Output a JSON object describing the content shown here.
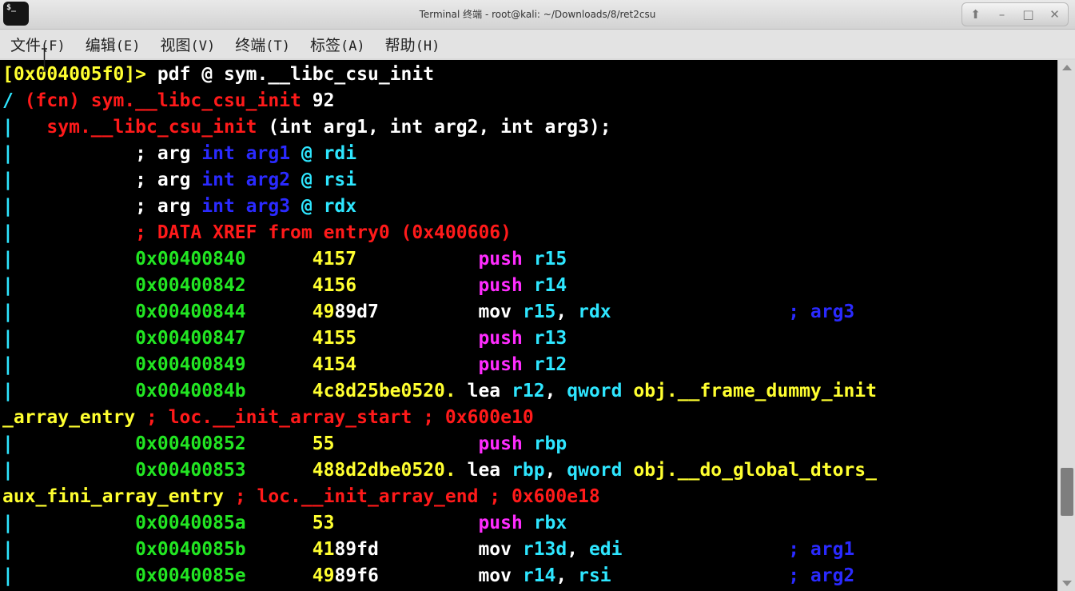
{
  "window": {
    "app_icon_text": "$_",
    "title": "Terminal 终端 - root@kali: ~/Downloads/8/ret2csu",
    "controls": {
      "up": "⬆",
      "minimize": "–",
      "maximize": "□",
      "close": "✕"
    }
  },
  "menu": [
    {
      "label": "文件",
      "accel": "(F)"
    },
    {
      "label": "编辑",
      "accel": "(E)"
    },
    {
      "label": "视图",
      "accel": "(V)"
    },
    {
      "label": "终端",
      "accel": "(T)"
    },
    {
      "label": "标签",
      "accel": "(A)"
    },
    {
      "label": "帮助",
      "accel": "(H)"
    }
  ],
  "colors": {
    "background": "#000000",
    "yellow": "#ffff30",
    "red": "#ff1a1a",
    "cyan": "#2ee6ff",
    "blue": "#2a2aff",
    "green": "#22e622",
    "magenta": "#ff2cff"
  },
  "terminal_lines": [
    [
      {
        "t": "[0x004005f0]> ",
        "c": "yellow"
      },
      {
        "t": "pdf @ sym.__libc_csu_init",
        "c": "white"
      }
    ],
    [
      {
        "t": "/ ",
        "c": "cyan"
      },
      {
        "t": "(fcn) sym.__libc_csu_init ",
        "c": "red"
      },
      {
        "t": "92",
        "c": "white"
      }
    ],
    [
      {
        "t": "|",
        "c": "cyan"
      },
      {
        "t": "   sym.__libc_csu_init ",
        "c": "red"
      },
      {
        "t": "(int arg1, int arg2, int arg3);",
        "c": "white"
      }
    ],
    [
      {
        "t": "|",
        "c": "cyan"
      },
      {
        "t": "           ; arg ",
        "c": "white"
      },
      {
        "t": "int arg1 ",
        "c": "blue"
      },
      {
        "t": "@ rdi",
        "c": "cyan"
      }
    ],
    [
      {
        "t": "|",
        "c": "cyan"
      },
      {
        "t": "           ; arg ",
        "c": "white"
      },
      {
        "t": "int arg2 ",
        "c": "blue"
      },
      {
        "t": "@ rsi",
        "c": "cyan"
      }
    ],
    [
      {
        "t": "|",
        "c": "cyan"
      },
      {
        "t": "           ; arg ",
        "c": "white"
      },
      {
        "t": "int arg3 ",
        "c": "blue"
      },
      {
        "t": "@ rdx",
        "c": "cyan"
      }
    ],
    [
      {
        "t": "|",
        "c": "cyan"
      },
      {
        "t": "           ; DATA XREF from entry0 (0x400606)",
        "c": "red"
      }
    ],
    [
      {
        "t": "|",
        "c": "cyan"
      },
      {
        "t": "           0x00400840",
        "c": "green"
      },
      {
        "t": "      4157",
        "c": "yellow"
      },
      {
        "t": "           push ",
        "c": "magenta"
      },
      {
        "t": "r15",
        "c": "cyan"
      }
    ],
    [
      {
        "t": "|",
        "c": "cyan"
      },
      {
        "t": "           0x00400842",
        "c": "green"
      },
      {
        "t": "      4156",
        "c": "yellow"
      },
      {
        "t": "           push ",
        "c": "magenta"
      },
      {
        "t": "r14",
        "c": "cyan"
      }
    ],
    [
      {
        "t": "|",
        "c": "cyan"
      },
      {
        "t": "           0x00400844",
        "c": "green"
      },
      {
        "t": "      49",
        "c": "yellow"
      },
      {
        "t": "89d7",
        "c": "white"
      },
      {
        "t": "         mov ",
        "c": "white"
      },
      {
        "t": "r15",
        "c": "cyan"
      },
      {
        "t": ", ",
        "c": "white"
      },
      {
        "t": "rdx",
        "c": "cyan"
      },
      {
        "t": "                ; ",
        "c": "blue"
      },
      {
        "t": "arg3",
        "c": "blue"
      }
    ],
    [
      {
        "t": "|",
        "c": "cyan"
      },
      {
        "t": "           0x00400847",
        "c": "green"
      },
      {
        "t": "      4155",
        "c": "yellow"
      },
      {
        "t": "           push ",
        "c": "magenta"
      },
      {
        "t": "r13",
        "c": "cyan"
      }
    ],
    [
      {
        "t": "|",
        "c": "cyan"
      },
      {
        "t": "           0x00400849",
        "c": "green"
      },
      {
        "t": "      4154",
        "c": "yellow"
      },
      {
        "t": "           push ",
        "c": "magenta"
      },
      {
        "t": "r12",
        "c": "cyan"
      }
    ],
    [
      {
        "t": "|",
        "c": "cyan"
      },
      {
        "t": "           0x0040084b",
        "c": "green"
      },
      {
        "t": "      4c8d25be0520.",
        "c": "yellow"
      },
      {
        "t": " lea ",
        "c": "white"
      },
      {
        "t": "r12",
        "c": "cyan"
      },
      {
        "t": ", ",
        "c": "white"
      },
      {
        "t": "qword ",
        "c": "cyan"
      },
      {
        "t": "obj.__frame_dummy_init",
        "c": "yellow"
      }
    ],
    [
      {
        "t": "_array_entry ",
        "c": "yellow"
      },
      {
        "t": "; loc.__init_array_start ; 0x600e10",
        "c": "red"
      }
    ],
    [
      {
        "t": "|",
        "c": "cyan"
      },
      {
        "t": "           0x00400852",
        "c": "green"
      },
      {
        "t": "      55",
        "c": "yellow"
      },
      {
        "t": "             push ",
        "c": "magenta"
      },
      {
        "t": "rbp",
        "c": "cyan"
      }
    ],
    [
      {
        "t": "|",
        "c": "cyan"
      },
      {
        "t": "           0x00400853",
        "c": "green"
      },
      {
        "t": "      488d2dbe0520.",
        "c": "yellow"
      },
      {
        "t": " lea ",
        "c": "white"
      },
      {
        "t": "rbp",
        "c": "cyan"
      },
      {
        "t": ", ",
        "c": "white"
      },
      {
        "t": "qword ",
        "c": "cyan"
      },
      {
        "t": "obj.__do_global_dtors_",
        "c": "yellow"
      }
    ],
    [
      {
        "t": "aux_fini_array_entry ",
        "c": "yellow"
      },
      {
        "t": "; loc.__init_array_end ; 0x600e18",
        "c": "red"
      }
    ],
    [
      {
        "t": "|",
        "c": "cyan"
      },
      {
        "t": "           0x0040085a",
        "c": "green"
      },
      {
        "t": "      53",
        "c": "yellow"
      },
      {
        "t": "             push ",
        "c": "magenta"
      },
      {
        "t": "rbx",
        "c": "cyan"
      }
    ],
    [
      {
        "t": "|",
        "c": "cyan"
      },
      {
        "t": "           0x0040085b",
        "c": "green"
      },
      {
        "t": "      41",
        "c": "yellow"
      },
      {
        "t": "89fd",
        "c": "white"
      },
      {
        "t": "         mov ",
        "c": "white"
      },
      {
        "t": "r13d",
        "c": "cyan"
      },
      {
        "t": ", ",
        "c": "white"
      },
      {
        "t": "edi",
        "c": "cyan"
      },
      {
        "t": "               ; ",
        "c": "blue"
      },
      {
        "t": "arg1",
        "c": "blue"
      }
    ],
    [
      {
        "t": "|",
        "c": "cyan"
      },
      {
        "t": "           0x0040085e",
        "c": "green"
      },
      {
        "t": "      49",
        "c": "yellow"
      },
      {
        "t": "89f6",
        "c": "white"
      },
      {
        "t": "         mov ",
        "c": "white"
      },
      {
        "t": "r14",
        "c": "cyan"
      },
      {
        "t": ", ",
        "c": "white"
      },
      {
        "t": "rsi",
        "c": "cyan"
      },
      {
        "t": "                ; ",
        "c": "blue"
      },
      {
        "t": "arg2",
        "c": "blue"
      }
    ]
  ]
}
